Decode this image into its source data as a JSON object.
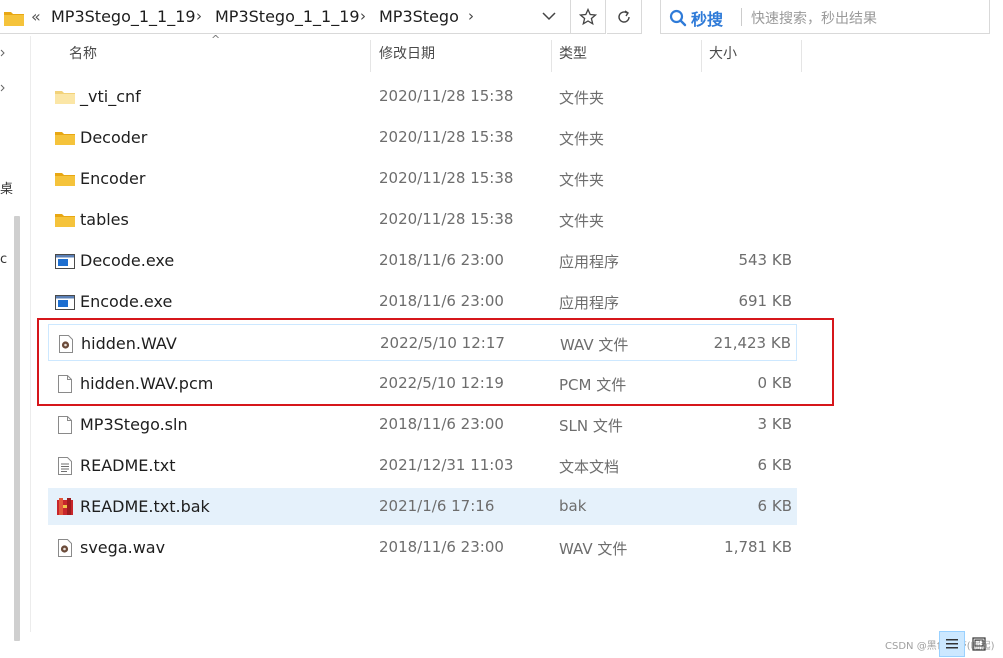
{
  "address_bar": {
    "overflow_glyph": "«",
    "crumbs": [
      "MP3Stego_1_1_19",
      "MP3Stego_1_1_19",
      "MP3Stego"
    ],
    "separator": "›"
  },
  "search": {
    "brand_label": "秒搜",
    "placeholder": "快速搜索，秒出结果"
  },
  "left_nav": {
    "fragments": [
      "桌",
      "c"
    ]
  },
  "columns": {
    "name": "名称",
    "date": "修改日期",
    "type": "类型",
    "size": "大小",
    "sort_glyph": "^"
  },
  "files": [
    {
      "name": "_vti_cnf",
      "date": "2020/11/28 15:38",
      "type": "文件夹",
      "size": "",
      "icon": "folder-light-icon"
    },
    {
      "name": "Decoder",
      "date": "2020/11/28 15:38",
      "type": "文件夹",
      "size": "",
      "icon": "folder-icon"
    },
    {
      "name": "Encoder",
      "date": "2020/11/28 15:38",
      "type": "文件夹",
      "size": "",
      "icon": "folder-icon"
    },
    {
      "name": "tables",
      "date": "2020/11/28 15:38",
      "type": "文件夹",
      "size": "",
      "icon": "folder-icon"
    },
    {
      "name": "Decode.exe",
      "date": "2018/11/6 23:00",
      "type": "应用程序",
      "size": "543 KB",
      "icon": "exe-icon"
    },
    {
      "name": "Encode.exe",
      "date": "2018/11/6 23:00",
      "type": "应用程序",
      "size": "691 KB",
      "icon": "exe-icon"
    },
    {
      "name": "hidden.WAV",
      "date": "2022/5/10 12:17",
      "type": "WAV 文件",
      "size": "21,423 KB",
      "icon": "audio-file-icon"
    },
    {
      "name": "hidden.WAV.pcm",
      "date": "2022/5/10 12:19",
      "type": "PCM 文件",
      "size": "0 KB",
      "icon": "blank-file-icon"
    },
    {
      "name": "MP3Stego.sln",
      "date": "2018/11/6 23:00",
      "type": "SLN 文件",
      "size": "3 KB",
      "icon": "blank-file-icon"
    },
    {
      "name": "README.txt",
      "date": "2021/12/31 11:03",
      "type": "文本文档",
      "size": "6 KB",
      "icon": "text-file-icon"
    },
    {
      "name": "README.txt.bak",
      "date": "2021/1/6 17:16",
      "type": "bak",
      "size": "6 KB",
      "icon": "archive-file-icon"
    },
    {
      "name": "svega.wav",
      "date": "2018/11/6 23:00",
      "type": "WAV 文件",
      "size": "1,781 KB",
      "icon": "audio-file-icon"
    }
  ],
  "selected_file": "README.txt.bak",
  "watermark": "CSDN @黑色地带(崛起)",
  "colors": {
    "highlight_border": "#d6161b",
    "selection": "#e5f1fb",
    "folder": "#f5c33b",
    "search_brand": "#2f7bd8"
  }
}
